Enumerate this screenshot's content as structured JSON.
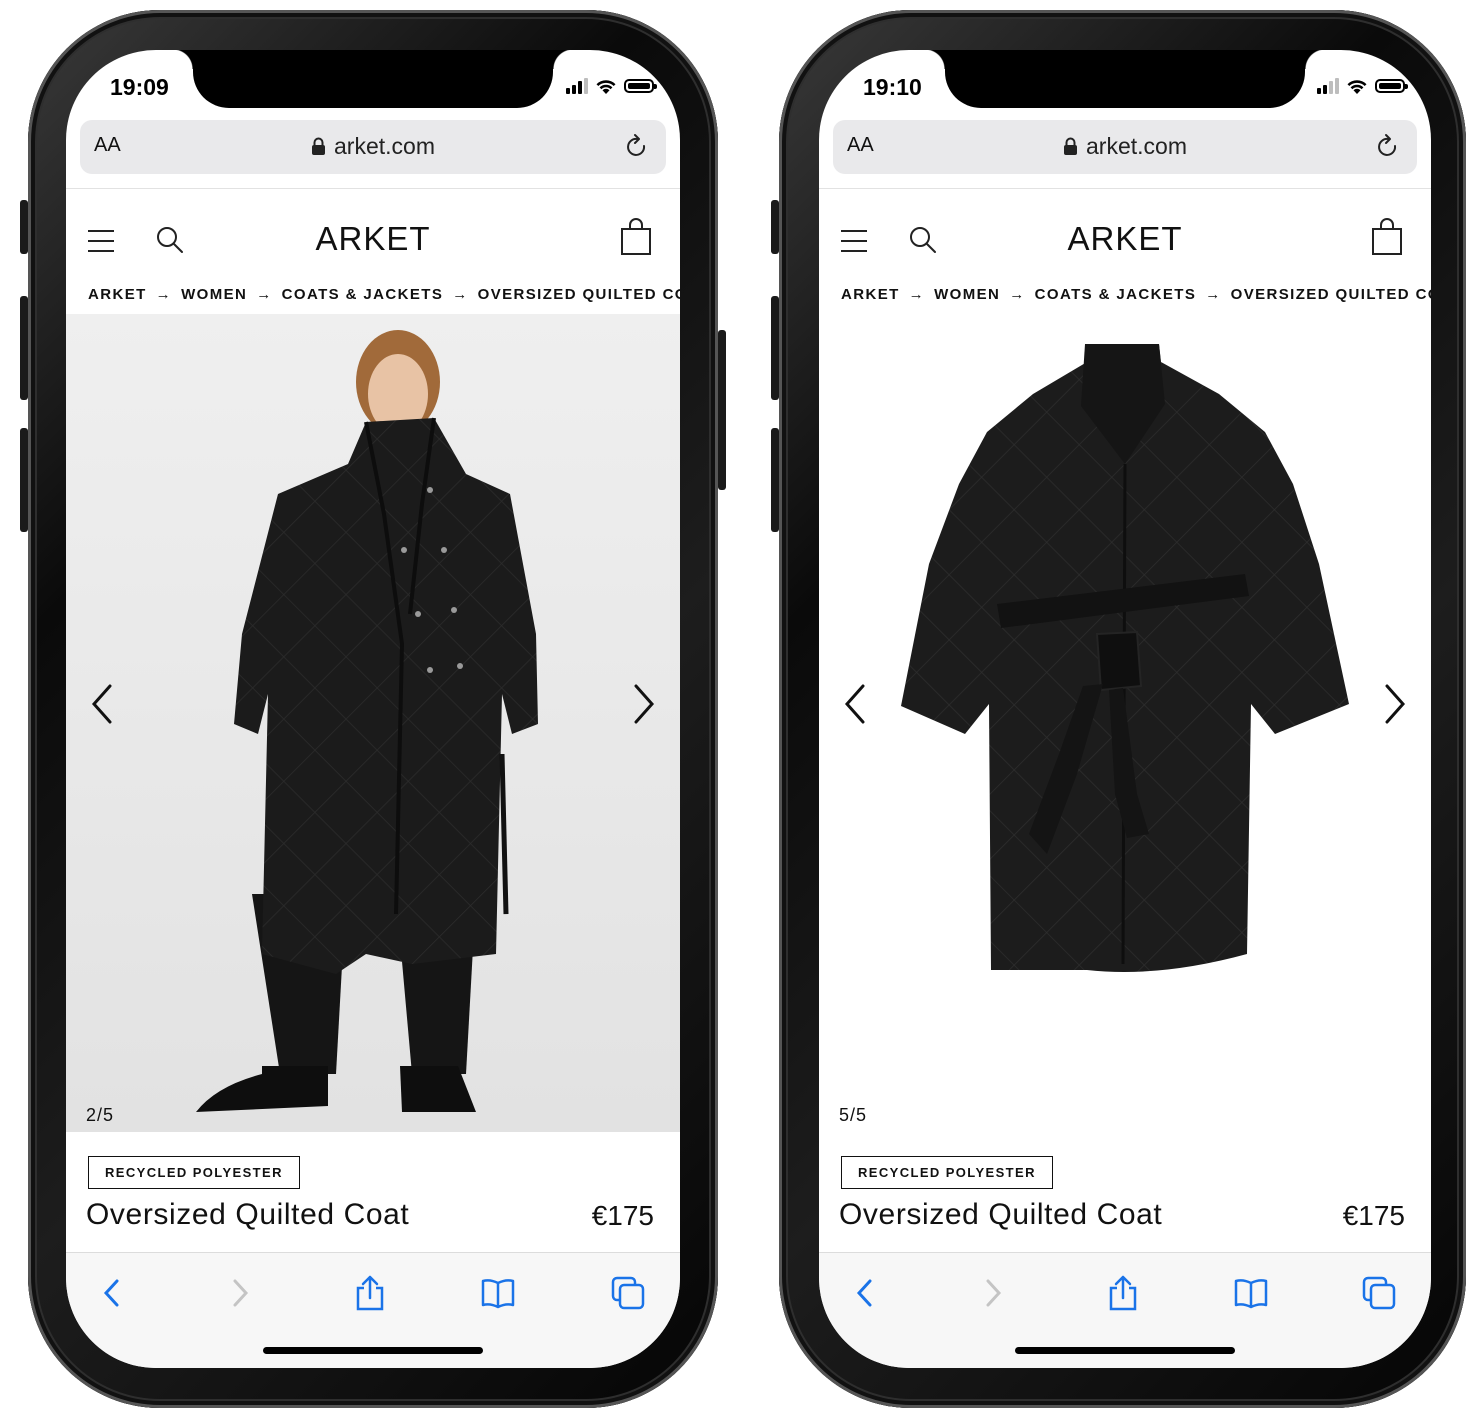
{
  "phones": [
    {
      "status": {
        "time": "19:09"
      },
      "browser": {
        "text_size_label": "AA",
        "url": "arket.com"
      },
      "site": {
        "logo": "ARKET",
        "breadcrumbs": [
          "ARKET",
          "WOMEN",
          "COATS & JACKETS",
          "OVERSIZED QUILTED CO"
        ],
        "breadcrumb_separator": "→"
      },
      "gallery": {
        "counter": "2/5",
        "current": 2,
        "total": 5,
        "image": "model wearing black quilted coat"
      },
      "product": {
        "tag": "RECYCLED POLYESTER",
        "title": "Oversized Quilted Coat",
        "price": "€175"
      }
    },
    {
      "status": {
        "time": "19:10"
      },
      "browser": {
        "text_size_label": "AA",
        "url": "arket.com"
      },
      "site": {
        "logo": "ARKET",
        "breadcrumbs": [
          "ARKET",
          "WOMEN",
          "COATS & JACKETS",
          "OVERSIZED QUILTED CO"
        ],
        "breadcrumb_separator": "→"
      },
      "gallery": {
        "counter": "5/5",
        "current": 5,
        "total": 5,
        "image": "black quilted coat flat with belt"
      },
      "product": {
        "tag": "RECYCLED POLYESTER",
        "title": "Oversized Quilted Coat",
        "price": "€175"
      }
    }
  ],
  "icons": {
    "browser": [
      "lock-icon",
      "reload-icon"
    ],
    "site": [
      "menu-icon",
      "search-icon",
      "bag-icon"
    ],
    "gallery": [
      "chevron-left-icon",
      "chevron-right-icon"
    ],
    "toolbar": [
      "back-icon",
      "forward-icon",
      "share-icon",
      "bookmarks-icon",
      "tabs-icon"
    ]
  },
  "colors": {
    "ios_blue": "#1a73e8",
    "text": "#111111",
    "gallery_bg": "#e8e8e8"
  }
}
